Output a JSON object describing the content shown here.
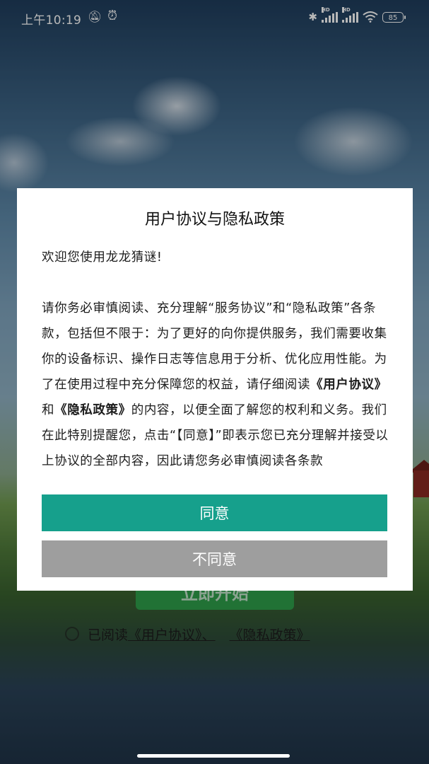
{
  "status_bar": {
    "time": "上午10:19",
    "battery": "85",
    "icons": [
      "notifications-muted-icon",
      "alarm-icon",
      "bluetooth-icon",
      "signal-hd-icon",
      "signal-hd-icon",
      "wifi-icon",
      "battery-icon"
    ]
  },
  "background": {
    "start_button_label": "立即开始",
    "agree_prefix": "已阅读",
    "agree_link_user": "《用户协议》",
    "agree_sep": "、",
    "agree_link_privacy": "《隐私政策》"
  },
  "dialog": {
    "title": "用户协议与隐私政策",
    "welcome": "欢迎您使用龙龙猜谜!",
    "body_part1": "请你务必审慎阅读、充分理解“服务协议”和“隐私政策”各条款，包括但不限于：为了更好的向你提供服务，我们需要收集你的设备标识、操作日志等信息用于分析、优化应用性能。为了在使用过程中充分保障您的权益，请仔细阅读",
    "body_link_user": "《用户协议》",
    "body_and": "和",
    "body_link_privacy": "《隐私政策》",
    "body_part2": "的内容，以便全面了解您的权利和义务。我们在此特别提醒您，点击“【同意】”即表示您已充分理解并接受以上协议的全部内容，因此请您务必审慎阅读各条款",
    "agree_button": "同意",
    "disagree_button": "不同意"
  },
  "colors": {
    "agree": "#16a08c",
    "disagree": "#9e9e9e",
    "start": "#2f9e4a"
  }
}
